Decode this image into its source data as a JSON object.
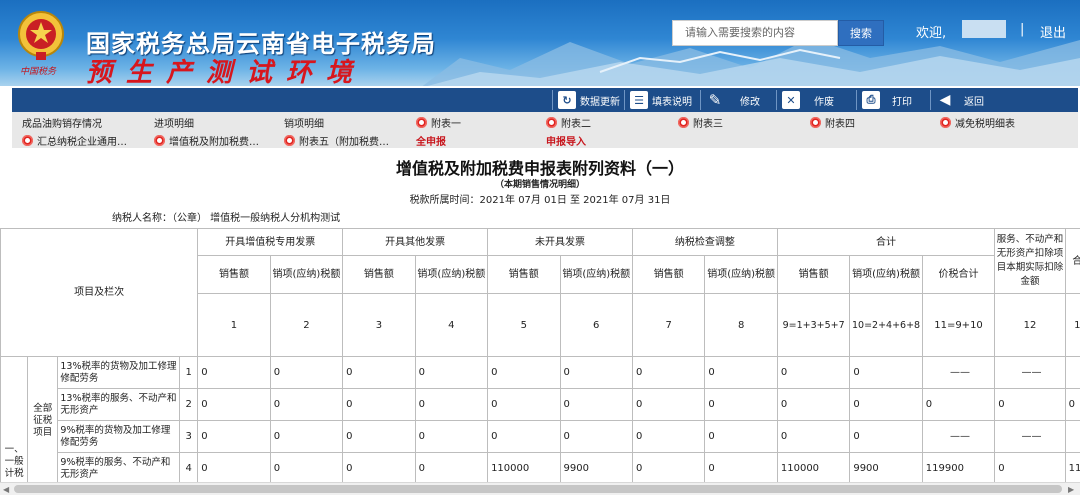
{
  "header": {
    "title": "国家税务总局云南省电子税务局",
    "subtitle": "预生产测试环境",
    "seal_text": "中国税务",
    "search_placeholder": "请输入需要搜索的内容",
    "search_button": "搜索",
    "welcome": "欢迎,",
    "separator": "|",
    "logout": "退出"
  },
  "toolbar": [
    {
      "label": "数据更新",
      "icon": "refresh-doc-icon"
    },
    {
      "label": "填表说明",
      "icon": "instructions-icon"
    },
    {
      "label": "修改",
      "icon": "edit-icon"
    },
    {
      "label": "作废",
      "icon": "void-doc-icon"
    },
    {
      "label": "打印",
      "icon": "print-icon"
    },
    {
      "label": "返回",
      "icon": "back-arrow-icon"
    }
  ],
  "tabs_row1": [
    {
      "label": "成品油购销存情况"
    },
    {
      "label": "进项明细"
    },
    {
      "label": "销项明细"
    },
    {
      "label": "附表一"
    },
    {
      "label": "附表二"
    },
    {
      "label": "附表三"
    },
    {
      "label": "附表四"
    },
    {
      "label": "减免税明细表"
    }
  ],
  "tabs_row2": [
    {
      "label": "汇总纳税企业通用…"
    },
    {
      "label": "增值税及附加税费…"
    },
    {
      "label": "附表五（附加税费…"
    },
    {
      "label": "全申报"
    },
    {
      "label": "申报导入"
    }
  ],
  "sheet": {
    "title": "增值税及附加税费申报表附列资料（一）",
    "subtitle": "（本期销售情况明细）",
    "period": "税款所属时间：2021年 07月 01日 至 2021年 07月 31日",
    "taxpayer": "纳税人名称：（公章） 增值税一般纳税人分机构测试"
  },
  "table": {
    "corner_label": "项目及栏次",
    "groups": [
      "开具增值税专用发票",
      "开具其他发票",
      "未开具发票",
      "纳税检查调整",
      "合计",
      "服务、不动产和无形资产扣除项目本期实际扣除金额",
      "合"
    ],
    "subheaders": [
      "销售额",
      "销项(应纳)税额",
      "销售额",
      "销项(应纳)税额",
      "销售额",
      "销项(应纳)税额",
      "销售额",
      "销项(应纳)税额",
      "销售额",
      "销项(应纳)税额",
      "价税合计"
    ],
    "col_numbers": [
      "1",
      "2",
      "3",
      "4",
      "5",
      "6",
      "7",
      "8",
      "9=1+3+5+7",
      "10=2+4+6+8",
      "11=9+10",
      "12",
      "1"
    ],
    "row_group_l1": "一、一般计税",
    "row_group_l2": "全部征税项目",
    "rows": [
      {
        "label": "13%税率的货物及加工修理修配劳务",
        "no": "1",
        "cells": [
          "0",
          "0",
          "0",
          "0",
          "0",
          "0",
          "0",
          "0",
          "0",
          "0",
          "——",
          "——",
          ""
        ]
      },
      {
        "label": "13%税率的服务、不动产和无形资产",
        "no": "2",
        "cells": [
          "0",
          "0",
          "0",
          "0",
          "0",
          "0",
          "0",
          "0",
          "0",
          "0",
          "0",
          "0",
          "0"
        ]
      },
      {
        "label": "9%税率的货物及加工修理修配劳务",
        "no": "3",
        "cells": [
          "0",
          "0",
          "0",
          "0",
          "0",
          "0",
          "0",
          "0",
          "0",
          "0",
          "——",
          "——",
          ""
        ]
      },
      {
        "label": "9%税率的服务、不动产和无形资产",
        "no": "4",
        "cells": [
          "0",
          "0",
          "0",
          "0",
          "110000",
          "9900",
          "0",
          "0",
          "110000",
          "9900",
          "119900",
          "0",
          "11"
        ]
      }
    ]
  }
}
